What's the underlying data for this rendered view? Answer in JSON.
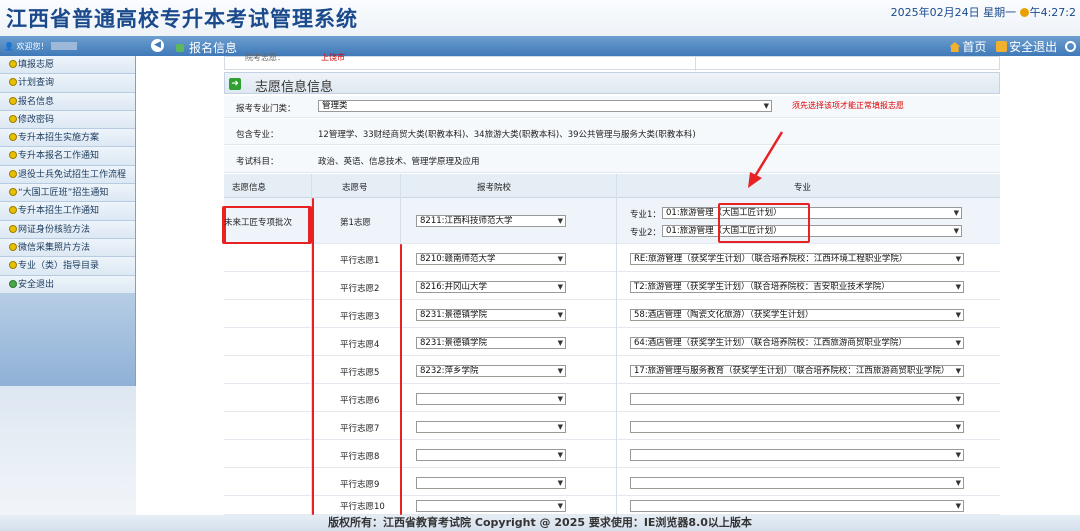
{
  "header": {
    "title": "江西省普通高校专升本考试管理系统",
    "datetime": "2025年02月24日 星期一",
    "time": "午4:27:2"
  },
  "nav": {
    "welcome": "欢迎您！",
    "location": "报名信息",
    "home": "首页",
    "logout": "安全退出"
  },
  "sidebar": {
    "items": [
      {
        "label": "填报志愿",
        "icon": "yellow-dot"
      },
      {
        "label": "计划查询",
        "icon": "yellow-dot"
      },
      {
        "label": "报名信息",
        "icon": "yellow-dot"
      },
      {
        "label": "修改密码",
        "icon": "yellow-dot"
      },
      {
        "label": "专升本招生实施方案",
        "icon": "yellow-dot"
      },
      {
        "label": "专升本报名工作通知",
        "icon": "yellow-dot"
      },
      {
        "label": "退役士兵免试招生工作流程",
        "icon": "yellow-dot"
      },
      {
        "label": "“大国工匠班”招生通知",
        "icon": "yellow-dot"
      },
      {
        "label": "专升本招生工作通知",
        "icon": "yellow-dot"
      },
      {
        "label": "网证身份核验方法",
        "icon": "yellow-dot"
      },
      {
        "label": "微信采集照片方法",
        "icon": "yellow-dot"
      },
      {
        "label": "专业（类）指导目录",
        "icon": "yellow-dot"
      },
      {
        "label": "安全退出",
        "icon": "green-dot"
      }
    ]
  },
  "form": {
    "top_label": "院考志愿：",
    "top_value": "上饶市",
    "section_title": "志愿信息信息",
    "category_label": "报考专业门类：",
    "category_value": "管理类",
    "category_warning": "须先选择该项才能正常填报志愿",
    "include_label": "包含专业：",
    "include_value": "12管理学、33财经商贸大类(职教本科)、34旅游大类(职教本科)、39公共管理与服务大类(职教本科)",
    "subjects_label": "考试科目：",
    "subjects_value": "政治、英语、信息技术、管理学原理及应用",
    "headers": {
      "info": "志愿信息",
      "number": "志愿号",
      "school": "报考院校",
      "major": "专业"
    },
    "special_batch": "未来工匠专项批次",
    "first_wish": {
      "label": "第1志愿",
      "school": "8211:江西科技师范大学",
      "major1_label": "专业1：",
      "major1_value": "01:旅游管理（大国工匠计划）",
      "major2_label": "专业2：",
      "major2_value": "01:旅游管理（大国工匠计划）"
    },
    "parallel": [
      {
        "label": "平行志愿1",
        "school": "8210:赣南师范大学",
        "major": "RE:旅游管理（获奖学生计划）（联合培养院校：江西环境工程职业学院）"
      },
      {
        "label": "平行志愿2",
        "school": "8216:井冈山大学",
        "major": "T2:旅游管理（获奖学生计划）（联合培养院校：吉安职业技术学院）"
      },
      {
        "label": "平行志愿3",
        "school": "8231:景德镇学院",
        "major": "58:酒店管理（陶瓷文化旅游）（获奖学生计划）"
      },
      {
        "label": "平行志愿4",
        "school": "8231:景德镇学院",
        "major": "64:酒店管理（获奖学生计划）（联合培养院校：江西旅游商贸职业学院）"
      },
      {
        "label": "平行志愿5",
        "school": "8232:萍乡学院",
        "major": "17:旅游管理与服务教育（获奖学生计划）（联合培养院校：江西旅游商贸职业学院）"
      },
      {
        "label": "平行志愿6",
        "school": "",
        "major": ""
      },
      {
        "label": "平行志愿7",
        "school": "",
        "major": ""
      },
      {
        "label": "平行志愿8",
        "school": "",
        "major": ""
      },
      {
        "label": "平行志愿9",
        "school": "",
        "major": ""
      },
      {
        "label": "平行志愿10",
        "school": "",
        "major": ""
      }
    ]
  },
  "footer": {
    "text": "版权所有：江西省教育考试院 Copyright @ 2025 要求使用：IE浏览器8.0以上版本"
  },
  "colors": {
    "accent": "#3f79b8",
    "title": "#1a4a8c",
    "annotation": "#e62222",
    "warning": "#dd0000"
  }
}
